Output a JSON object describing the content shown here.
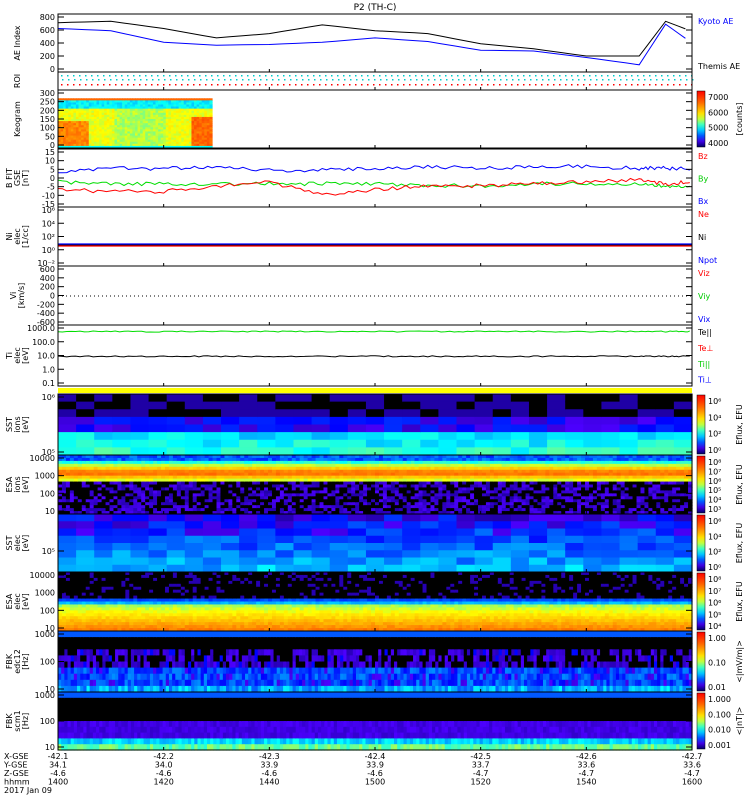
{
  "title": "P2 (TH-C)",
  "colors": {
    "kyoto": "#0000ff",
    "themis": "#000000",
    "bz": "#ff0000",
    "by": "#00dd00",
    "bx": "#0000ff",
    "yellow": "#ffff00"
  },
  "panels": [
    {
      "id": "ae",
      "ylabel": [
        "AE Index"
      ],
      "ticks": [
        "800",
        "600",
        "400",
        "200",
        "0"
      ],
      "legend": [
        {
          "text": "Kyoto AE",
          "color": "#0000ff"
        },
        {
          "text": "Themis AE",
          "color": "#000000"
        }
      ]
    },
    {
      "id": "roi",
      "ylabel": [
        "ROI"
      ],
      "ticks": [],
      "legend": []
    },
    {
      "id": "keogram",
      "ylabel": [
        "Keogram"
      ],
      "ticks": [
        "300",
        "250",
        "200",
        "150",
        "100",
        "50",
        "0"
      ],
      "cbar": [
        "7000",
        "6000",
        "5000",
        "4000"
      ],
      "cbar_unit": "[counts]"
    },
    {
      "id": "bfit",
      "ylabel": [
        "B FIT",
        "GSE",
        "[nT]"
      ],
      "ticks": [
        "15",
        "10",
        "5",
        "0",
        "-5",
        "-10",
        "-15"
      ],
      "legend": [
        {
          "text": "Bz",
          "color": "#ff0000"
        },
        {
          "text": "By",
          "color": "#00cc00"
        },
        {
          "text": "Bx",
          "color": "#0000ff"
        }
      ]
    },
    {
      "id": "ni",
      "ylabel": [
        "Ni",
        "elec",
        "[1/cc]"
      ],
      "ticks": [
        "10⁶",
        "10⁴",
        "10²",
        "10⁰",
        "10⁻²"
      ],
      "legend": [
        {
          "text": "Ne",
          "color": "#ff0000"
        },
        {
          "text": "Ni",
          "color": "#000000"
        },
        {
          "text": "Npot",
          "color": "#0000ff"
        }
      ]
    },
    {
      "id": "vi",
      "ylabel": [
        "Vi",
        "[km/s]"
      ],
      "ticks": [
        "600",
        "400",
        "200",
        "0",
        "-200",
        "-400",
        "-600"
      ],
      "legend": [
        {
          "text": "Viz",
          "color": "#ff0000"
        },
        {
          "text": "Viy",
          "color": "#00cc00"
        },
        {
          "text": "Vix",
          "color": "#0000ff"
        }
      ]
    },
    {
      "id": "ti",
      "ylabel": [
        "Ti",
        "elec",
        "[eV]"
      ],
      "ticks": [
        "1000.0",
        "100.0",
        "10.0",
        "1.0",
        "0.1"
      ],
      "legend": [
        {
          "text": "Te||",
          "color": "#000000"
        },
        {
          "text": "Te⊥",
          "color": "#ff0000"
        },
        {
          "text": "Ti||",
          "color": "#00cc00"
        },
        {
          "text": "Ti⊥",
          "color": "#0000ff"
        }
      ]
    },
    {
      "id": "sst_i",
      "ylabel": [
        "SST",
        "ions",
        "[eV]"
      ],
      "ticks": [
        "10⁶",
        "10⁵"
      ],
      "cbar": [
        "10⁶",
        "10⁴",
        "10²",
        "10⁰"
      ],
      "cbar_unit": "Eflux, EFU"
    },
    {
      "id": "esa_i",
      "ylabel": [
        "ESA",
        "ions",
        "[eV]"
      ],
      "ticks": [
        "10000",
        "1000",
        "100",
        "10"
      ],
      "cbar": [
        "10⁸",
        "10⁷",
        "10⁶",
        "10⁵",
        "10⁴",
        "10³"
      ],
      "cbar_unit": "Eflux, EFU"
    },
    {
      "id": "sst_e",
      "ylabel": [
        "SST",
        "elec",
        "[eV]"
      ],
      "ticks": [
        "10⁵"
      ],
      "cbar": [
        "10⁶",
        "10⁴",
        "10²",
        "10⁰"
      ],
      "cbar_unit": "Eflux, EFU"
    },
    {
      "id": "esa_e",
      "ylabel": [
        "ESA",
        "elec",
        "[eV]"
      ],
      "ticks": [
        "10000",
        "1000",
        "100",
        "10"
      ],
      "cbar": [
        "10⁸",
        "10⁷",
        "10⁶",
        "10⁵",
        "10⁴"
      ],
      "cbar_unit": "Eflux, EFU"
    },
    {
      "id": "fbk_e",
      "ylabel": [
        "FBK",
        "edc12",
        "[Hz]"
      ],
      "ticks": [
        "1000",
        "100",
        "10"
      ],
      "cbar": [
        "1.00",
        "0.10",
        "0.01"
      ],
      "cbar_unit": "<|mV/m|>"
    },
    {
      "id": "fbk_b",
      "ylabel": [
        "FBK",
        "scm1",
        "[Hz]"
      ],
      "ticks": [
        "1000",
        "100",
        "10"
      ],
      "cbar": [
        "1.000",
        "0.100",
        "0.010",
        "0.001"
      ],
      "cbar_unit": "<|nT|>"
    }
  ],
  "xaxis": {
    "rows": [
      {
        "label": "X-GSE",
        "values": [
          "-42.1",
          "-42.2",
          "-42.3",
          "-42.4",
          "-42.5",
          "-42.6",
          "-42.7"
        ]
      },
      {
        "label": "Y-GSE",
        "values": [
          "34.1",
          "34.0",
          "33.9",
          "33.9",
          "33.7",
          "33.6",
          "33.6"
        ]
      },
      {
        "label": "Z-GSE",
        "values": [
          "-4.6",
          "-4.6",
          "-4.6",
          "-4.6",
          "-4.7",
          "-4.7",
          "-4.7"
        ]
      },
      {
        "label": "hhmm",
        "values": [
          "1400",
          "1420",
          "1440",
          "1500",
          "1520",
          "1540",
          "1600"
        ]
      }
    ],
    "date": "2017 Jan 09"
  },
  "chart_data": {
    "type": "line",
    "title": "P2 (TH-C)",
    "x_label": "hhmm",
    "x": [
      1400,
      1410,
      1420,
      1430,
      1440,
      1450,
      1500,
      1510,
      1520,
      1530,
      1540,
      1550,
      1555,
      1600
    ],
    "series": [
      {
        "name": "Kyoto AE",
        "panel": "ae",
        "values": [
          600,
          570,
          410,
          370,
          380,
          410,
          470,
          420,
          300,
          290,
          200,
          100,
          660,
          400
        ]
      },
      {
        "name": "Themis AE",
        "panel": "ae",
        "values": [
          680,
          700,
          600,
          470,
          530,
          650,
          570,
          530,
          390,
          320,
          220,
          220,
          700,
          560
        ]
      },
      {
        "name": "Bx",
        "panel": "bfit",
        "values": [
          3,
          5,
          5,
          6,
          4,
          4,
          5,
          6,
          5,
          6,
          6,
          5,
          5,
          5
        ]
      },
      {
        "name": "By",
        "panel": "bfit",
        "values": [
          -2,
          -3,
          -3,
          -3,
          -3,
          -3,
          -3,
          -4,
          -4,
          -3,
          -3,
          -3,
          -4,
          -4
        ]
      },
      {
        "name": "Bz",
        "panel": "bfit",
        "values": [
          -6,
          -7,
          -7,
          -4,
          -2,
          -9,
          -6,
          -4,
          -4,
          -3,
          -2,
          -1,
          -3,
          -2
        ]
      },
      {
        "name": "Ti||",
        "panel": "ti",
        "values": [
          1000,
          1000,
          1000,
          1000,
          1000,
          1000,
          1000,
          1000,
          1000,
          1000,
          1000,
          1000,
          1000,
          1000
        ]
      },
      {
        "name": "Te||",
        "panel": "ti",
        "values": [
          15,
          15,
          15,
          15,
          15,
          15,
          15,
          15,
          15,
          15,
          15,
          15,
          15,
          15
        ]
      }
    ],
    "ylim": {
      "ae": [
        0,
        800
      ],
      "bfit": [
        -15,
        15
      ],
      "ti": [
        0.1,
        3000
      ]
    }
  }
}
